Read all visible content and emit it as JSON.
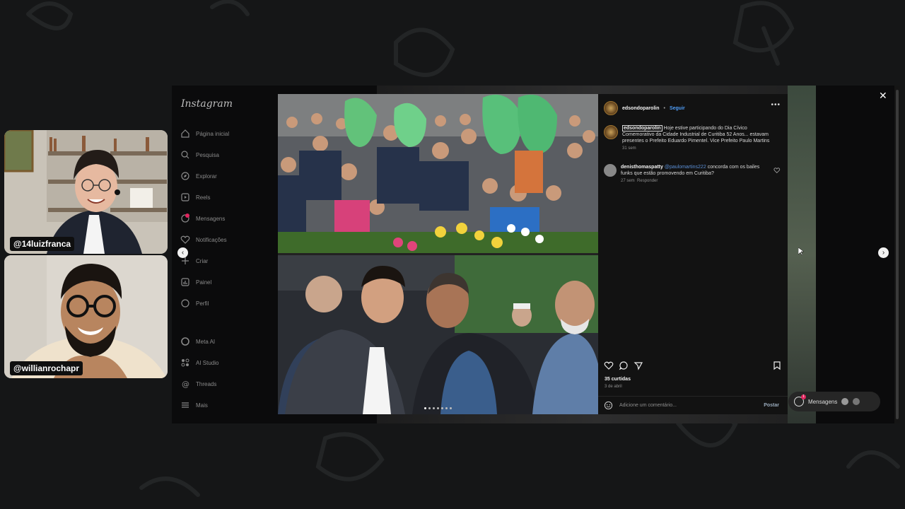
{
  "cams": [
    {
      "handle": "@14luizfranca"
    },
    {
      "handle": "@willianrochapr"
    }
  ],
  "instagram": {
    "logo": "Instagram",
    "nav": [
      {
        "label": "Página inicial",
        "icon": "home-icon"
      },
      {
        "label": "Pesquisa",
        "icon": "search-icon"
      },
      {
        "label": "Explorar",
        "icon": "compass-icon"
      },
      {
        "label": "Reels",
        "icon": "reels-icon"
      },
      {
        "label": "Mensagens",
        "icon": "messenger-icon"
      },
      {
        "label": "Notificações",
        "icon": "heart-icon"
      },
      {
        "label": "Criar",
        "icon": "plus-icon"
      },
      {
        "label": "Painel",
        "icon": "dashboard-icon"
      },
      {
        "label": "Perfil",
        "icon": "profile-icon"
      }
    ],
    "nav_bottom": [
      {
        "label": "Meta AI",
        "icon": "meta-ai-icon"
      },
      {
        "label": "AI Studio",
        "icon": "ai-studio-icon"
      },
      {
        "label": "Threads",
        "icon": "threads-icon"
      },
      {
        "label": "Mais",
        "icon": "menu-icon"
      }
    ],
    "badge_count": "1",
    "post": {
      "username": "edsondoparolin",
      "separator": "•",
      "follow": "Seguir",
      "caption": "Hoje estive participando do Dia Cívico Comemorativo da Cidade Industrial de Curitiba 52 Anos... estavam presentes o Prefeito Eduardo Pimentel. Vice Prefeito Paulo Martins",
      "caption_time": "31 sem",
      "comments": [
        {
          "user": "denisthomaspatty",
          "mention": "@paulomartins222",
          "text": "concorda com os bailes funks que estão promovendo em Curitiba?",
          "time": "27 sem",
          "reply": "Responder"
        }
      ],
      "likes": "35 curtidas",
      "date": "3 de abril",
      "add_comment_placeholder": "Adicione um comentário...",
      "post_button": "Postar"
    },
    "messages_pill": "Mensagens"
  }
}
